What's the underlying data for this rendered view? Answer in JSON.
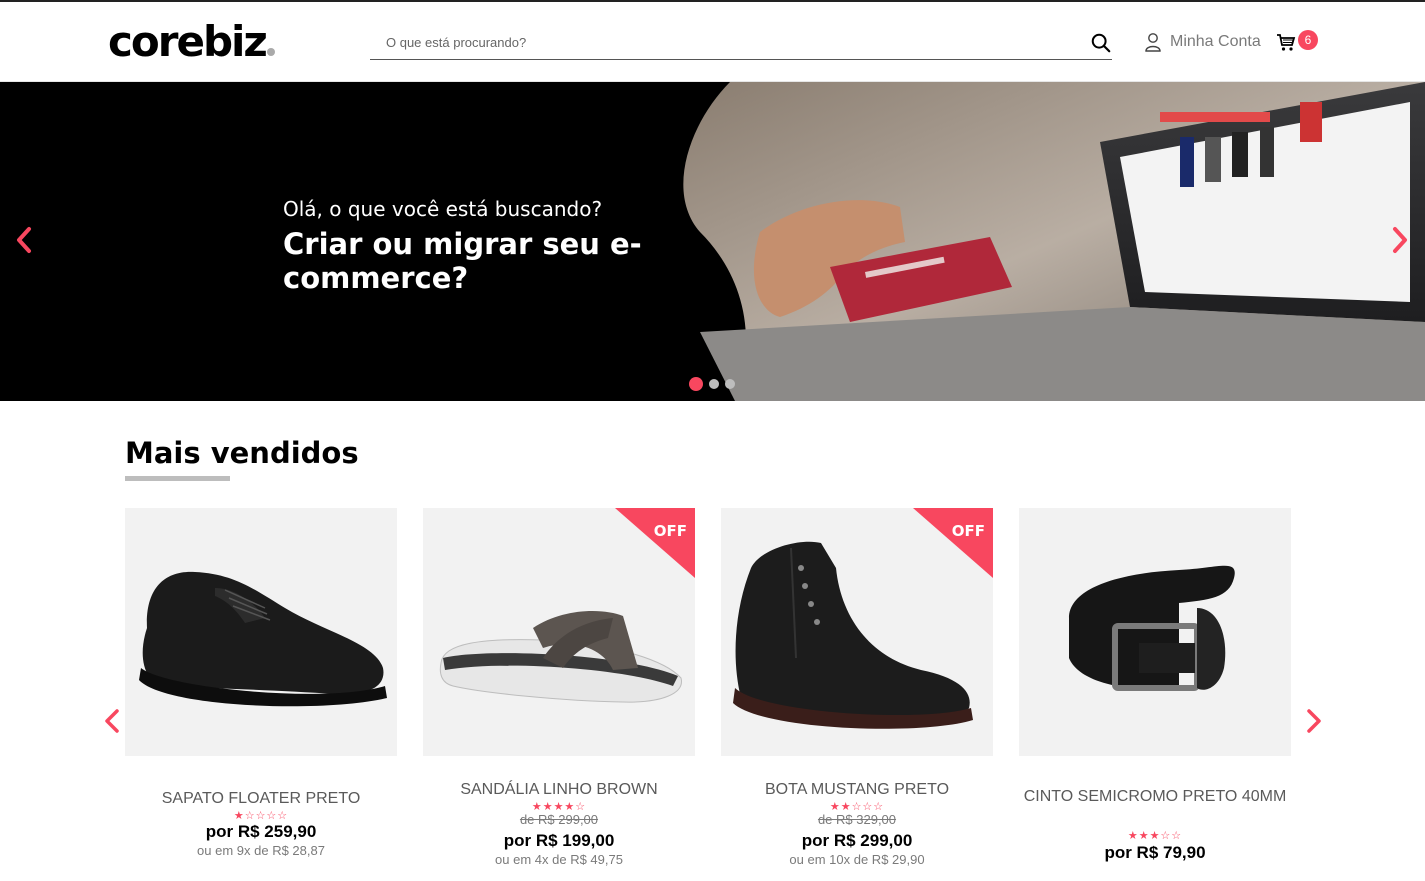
{
  "header": {
    "logo": "corebiz",
    "search_placeholder": "O que está procurando?",
    "account_label": "Minha Conta",
    "cart_count": "6"
  },
  "banner": {
    "subtitle": "Olá, o que você está buscando?",
    "title": "Criar ou migrar seu e-commerce?",
    "slides": 3,
    "active_slide": 1
  },
  "section": {
    "title": "Mais vendidos"
  },
  "products": [
    {
      "name": "SAPATO FLOATER PRETO",
      "rating": 1,
      "list_price": "",
      "price": "por R$ 259,90",
      "installments": "ou em 9x de R$ 28,87",
      "off": false
    },
    {
      "name": "SANDÁLIA LINHO BROWN",
      "rating": 4,
      "list_price": "de R$ 299,00",
      "price": "por R$ 199,00",
      "installments": "ou em 4x de R$ 49,75",
      "off": true,
      "off_label": "OFF"
    },
    {
      "name": "BOTA MUSTANG PRETO",
      "rating": 2,
      "list_price": "de R$ 329,00",
      "price": "por R$ 299,00",
      "installments": "ou em 10x de R$ 29,90",
      "off": true,
      "off_label": "OFF"
    },
    {
      "name": "CINTO SEMICROMO PRETO 40MM",
      "rating": 3,
      "list_price": "",
      "price": "por R$ 79,90",
      "installments": "",
      "off": false
    }
  ],
  "colors": {
    "accent": "#f8475f",
    "text": "#000000",
    "muted": "#7a7a7a"
  },
  "icons": {
    "search": "search-icon",
    "account": "user-icon",
    "cart": "cart-icon",
    "prev": "chevron-left-icon",
    "next": "chevron-right-icon"
  }
}
